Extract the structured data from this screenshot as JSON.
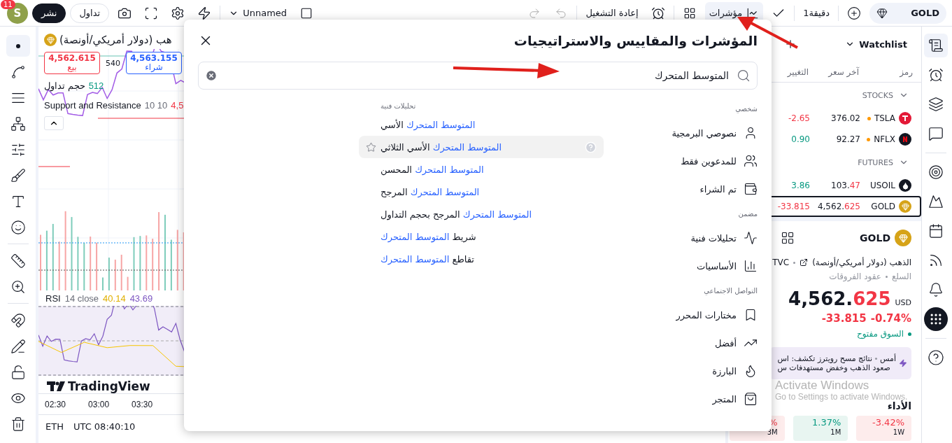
{
  "top_bar": {
    "avatar": "S",
    "notifications": "11",
    "publish": "نشر",
    "trade": "تداول",
    "layout_name": "Unnamed",
    "replay": "إعادة التشغيل",
    "indicators": {
      "label": "مؤشرات",
      "selected": true
    },
    "interval": "1دقيقة",
    "symbol": "GOLD"
  },
  "chart": {
    "title": "هب (دولار أمريكي/أونصة)",
    "sell": {
      "price": "4,562.615",
      "label": "بيع"
    },
    "spread": "540",
    "buy": {
      "price": "4,563.155",
      "label": "شراء"
    },
    "legends": [
      {
        "name": "حجم تداول",
        "value": "512",
        "kind": "volume"
      },
      {
        "name": "Support and Resistance",
        "params": "10 10",
        "value": "4,5",
        "kind": "study"
      }
    ],
    "rsi": {
      "name": "RSI",
      "params": "14 close",
      "values": [
        "43.69",
        "40.14"
      ]
    },
    "logo": "TradingView",
    "time_labels": [
      "03:30",
      "03:00",
      "02:30"
    ],
    "session": "ETH",
    "clock": "UTC 08:40:10"
  },
  "dialog": {
    "title": "المؤشرات والمقاييس والاستراتيجيات",
    "search": {
      "value": "المتوسط المتحرك"
    },
    "categories": [
      {
        "heading": "شخصي",
        "items": [
          {
            "label": "نصوصي البرمجية",
            "kind": "user"
          },
          {
            "label": "للمدعوين فقط",
            "kind": "users"
          },
          {
            "label": "تم الشراء",
            "kind": "wallet"
          }
        ]
      },
      {
        "heading": "مضمن",
        "items": [
          {
            "label": "تحليلات فنية",
            "kind": "technicals"
          },
          {
            "label": "الأساسيات",
            "kind": "fundamentals"
          }
        ]
      },
      {
        "heading": "التواصل الاجتماعي",
        "items": [
          {
            "label": "مختارات المحرر",
            "kind": "bookmark"
          },
          {
            "label": "أفضل",
            "kind": "top"
          },
          {
            "label": "البارزة",
            "kind": "trending"
          },
          {
            "label": "المتجر",
            "kind": "store"
          }
        ]
      }
    ],
    "results_heading": "تحليلات فنية",
    "results": [
      {
        "selected": false,
        "parts": [
          {
            "text": "المتوسط المتحرك",
            "match": true
          },
          {
            "text": "الأسي",
            "match": false
          }
        ]
      },
      {
        "selected": true,
        "parts": [
          {
            "text": "المتوسط المتحرك",
            "match": true
          },
          {
            "text": "الأسي الثلاثي",
            "match": false
          }
        ]
      },
      {
        "selected": false,
        "parts": [
          {
            "text": "المتوسط المتحرك",
            "match": true
          },
          {
            "text": "المحسن",
            "match": false
          }
        ]
      },
      {
        "selected": false,
        "parts": [
          {
            "text": "المتوسط المتحرك",
            "match": true
          },
          {
            "text": "المرجح",
            "match": false
          }
        ]
      },
      {
        "selected": false,
        "parts": [
          {
            "text": "المتوسط المتحرك",
            "match": true
          },
          {
            "text": "المرجح بحجم التداول",
            "match": false
          }
        ]
      },
      {
        "selected": false,
        "parts": [
          {
            "text": "شريط",
            "match": false
          },
          {
            "text": "المتوسط المتحرك",
            "match": true
          }
        ]
      },
      {
        "selected": false,
        "parts": [
          {
            "text": "تقاطع",
            "match": false
          },
          {
            "text": "المتوسط المتحرك",
            "match": true
          }
        ]
      }
    ]
  },
  "watchlist": {
    "title": "Watchlist",
    "columns": [
      "رمز",
      "آخر سعر",
      "التغيير"
    ],
    "groups": [
      {
        "name": "STOCKS",
        "rows": [
          {
            "symbol": "TSLA",
            "kind": "tesla",
            "dot": true,
            "last": "376.02",
            "change": "-2.65",
            "negative": true,
            "selected": false
          },
          {
            "symbol": "NFLX",
            "kind": "netflix",
            "dot": true,
            "last": "92.27",
            "change": "0.90",
            "negative": false,
            "selected": false
          }
        ]
      },
      {
        "name": "FUTURES",
        "rows": [
          {
            "symbol": "USOIL",
            "kind": "oil",
            "dot": false,
            "last": "103.",
            "last_fraction": "47",
            "change": "3.86",
            "negative": false,
            "selected": false
          },
          {
            "symbol": "GOLD",
            "kind": "gold",
            "dot": false,
            "last": "4,562.",
            "last_fraction": "625",
            "change": "-33.815",
            "negative": true,
            "selected": true
          }
        ]
      }
    ],
    "detail": {
      "symbol": "GOLD",
      "name": "الذهب (دولار أمريكي/أونصة)",
      "source": "TVC",
      "categories": [
        "السلع",
        "عقود الفروقات"
      ],
      "price_whole": "4,562.",
      "price_fraction": "625",
      "currency": "USD",
      "change": "-33.815",
      "change_percent": "-0.74%",
      "status": "السوق مفتوح",
      "news": {
        "time": "أمس",
        "lines": [
          "نتائج مسح رويترز تكشف: اس",
          "صعود الذهب وخفض مستهدفات س"
        ]
      },
      "performance_title": "الأداء",
      "performance": [
        {
          "value": "-3.42%",
          "period": "1W",
          "negative": true
        },
        {
          "value": "1.37%",
          "period": "1M",
          "negative": false
        },
        {
          "value": "%",
          "period": "3M",
          "negative": true
        }
      ]
    }
  },
  "os_notice": {
    "title": "Activate Windows",
    "subtitle": "Go to Settings to activate Windows."
  }
}
